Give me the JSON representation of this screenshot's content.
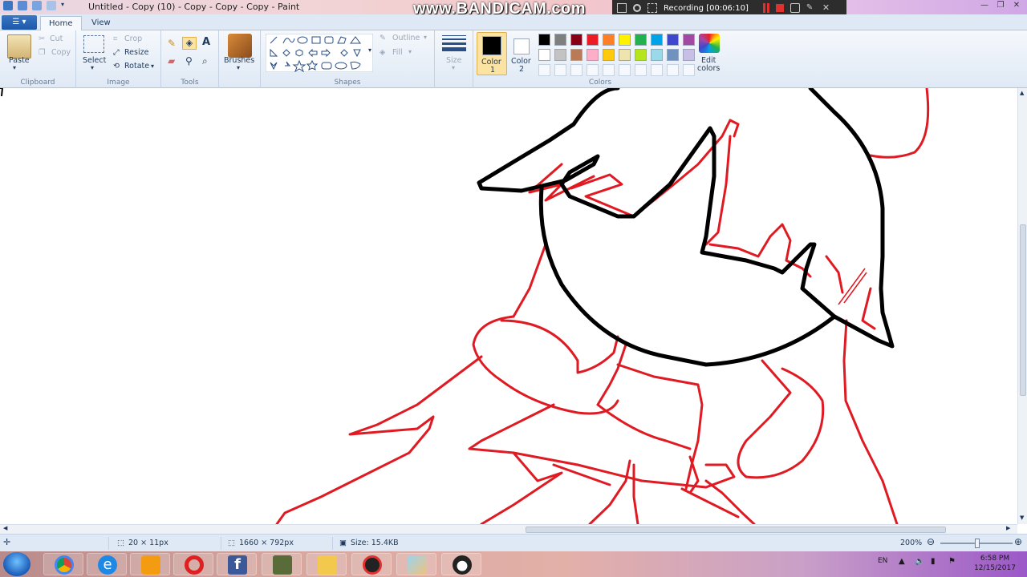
{
  "window": {
    "title": "Untitled - Copy (10) - Copy - Copy - Copy - Paint"
  },
  "overlay": {
    "watermark": "www.BANDICAM.com",
    "recording": "Recording [00:06:10]"
  },
  "tabs": {
    "file_label": "",
    "home": "Home",
    "view": "View"
  },
  "ribbon": {
    "clipboard": {
      "paste": "Paste",
      "cut": "Cut",
      "copy": "Copy",
      "label": "Clipboard"
    },
    "image": {
      "select": "Select",
      "crop": "Crop",
      "resize": "Resize",
      "rotate": "Rotate",
      "label": "Image"
    },
    "tools": {
      "label": "Tools"
    },
    "brushes": {
      "label": "Brushes"
    },
    "shapes": {
      "outline": "Outline",
      "fill": "Fill",
      "label": "Shapes"
    },
    "size": {
      "label": "Size"
    },
    "color1": {
      "label": "Color",
      "num": "1"
    },
    "color2": {
      "label": "Color",
      "num": "2"
    },
    "colors": {
      "label": "Colors",
      "edit": "Edit",
      "edit2": "colors"
    }
  },
  "palette": {
    "row1": [
      "#000000",
      "#7f7f7f",
      "#880015",
      "#ed1c24",
      "#ff7f27",
      "#fff200",
      "#22b14c",
      "#00a2e8",
      "#3f48cc",
      "#a349a4"
    ],
    "row2": [
      "#ffffff",
      "#c3c3c3",
      "#b97a57",
      "#ffaec9",
      "#ffc90e",
      "#efe4b0",
      "#b5e61d",
      "#99d9ea",
      "#7092be",
      "#c8bfe7"
    ],
    "primary": "#000000",
    "secondary": "#ffffff"
  },
  "status": {
    "cursor": "20 × 11px",
    "canvas_size": "1660 × 792px",
    "file_size": "Size: 15.4KB",
    "zoom": "200%"
  },
  "taskbar": {
    "lang": "EN",
    "time": "6:58 PM",
    "date": "12/15/2017"
  }
}
